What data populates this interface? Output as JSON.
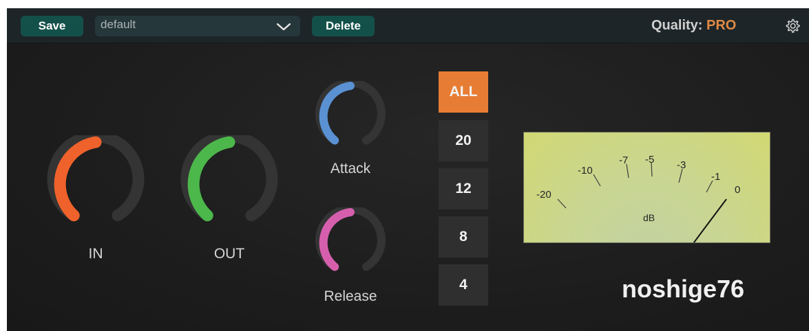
{
  "toolbar": {
    "save_label": "Save",
    "preset_value": "default",
    "delete_label": "Delete",
    "quality_label": "Quality:",
    "quality_value": "PRO"
  },
  "knobs": {
    "in": {
      "label": "IN",
      "color": "#f0622b"
    },
    "out": {
      "label": "OUT",
      "color": "#4cb84b"
    },
    "attack": {
      "label": "Attack",
      "color": "#5a91d3"
    },
    "release": {
      "label": "Release",
      "color": "#d65fad"
    }
  },
  "ratio_buttons": [
    "ALL",
    "20",
    "12",
    "8",
    "4"
  ],
  "ratio_selected": "ALL",
  "meter": {
    "scale": [
      "-20",
      "-10",
      "-7",
      "-5",
      "-3",
      "-1",
      "0"
    ],
    "unit": "dB"
  },
  "brand": "noshige76",
  "colors": {
    "accent": "#e77d34",
    "button_bg": "#14504a"
  },
  "icons": {
    "settings": "gear-icon",
    "dropdown": "chevron-down-icon"
  }
}
